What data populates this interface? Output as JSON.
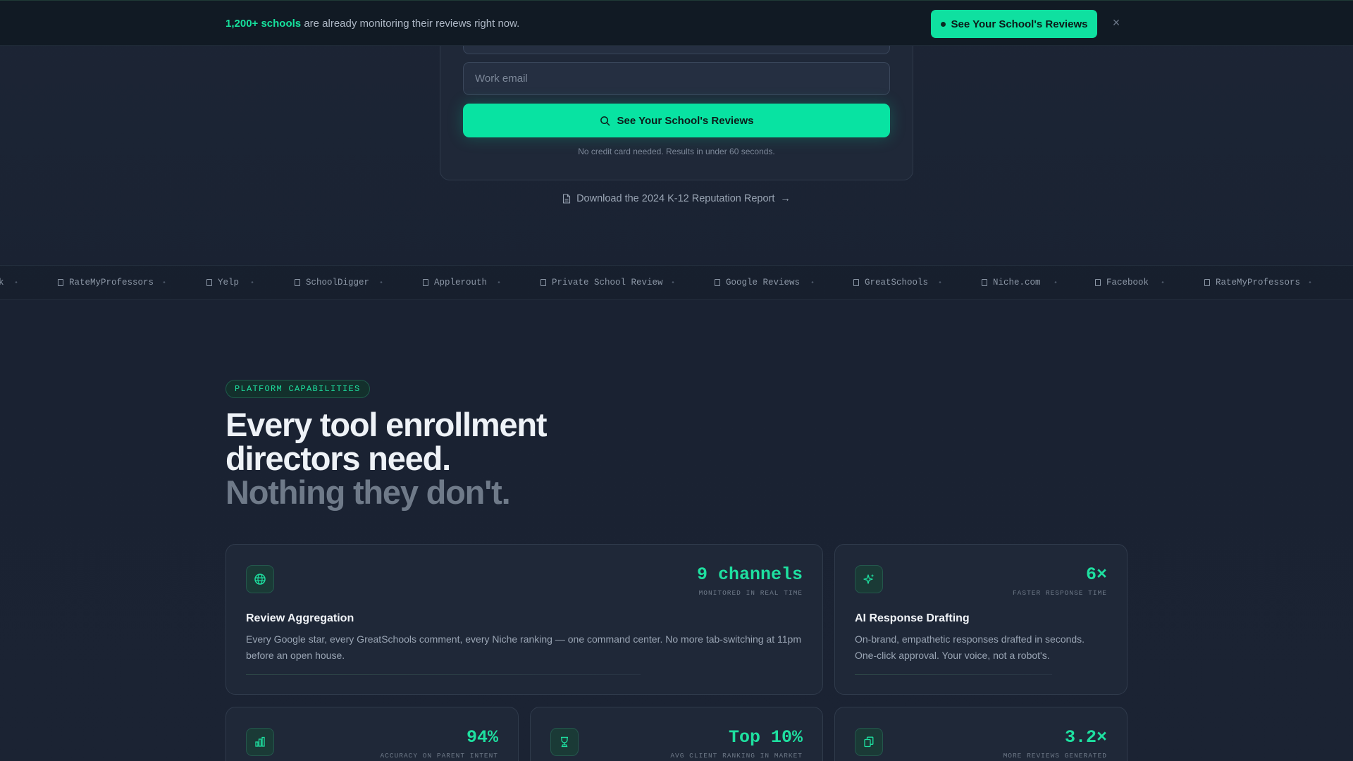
{
  "banner": {
    "highlight": "1,200+ schools",
    "text": " are already monitoring their reviews right now.",
    "button_label": "See Your School's Reviews",
    "close_glyph": "×"
  },
  "form": {
    "email_placeholder": "Work email",
    "cta_label": "See Your School's Reviews",
    "fine_print": "No credit card needed. Results in under 60 seconds.",
    "download_label": "Download the 2024 K-12 Reputation Report",
    "download_arrow": "→"
  },
  "marquee": {
    "leading": "k",
    "items": [
      "RateMyProfessors",
      "Yelp",
      "SchoolDigger",
      "Applerouth",
      "Private School Review",
      "Google Reviews",
      "GreatSchools",
      "Niche.com",
      "Facebook",
      "RateMyProfessors"
    ],
    "separator": "•"
  },
  "section": {
    "badge": "PLATFORM CAPABILITIES",
    "headline_line1": "Every tool enrollment",
    "headline_line2": "directors need.",
    "headline_line3": "Nothing they don't."
  },
  "cards": [
    {
      "icon": "globe-icon",
      "stat": "9 channels",
      "stat_label": "MONITORED IN REAL TIME",
      "title": "Review Aggregation",
      "desc": "Every Google star, every GreatSchools comment, every Niche ranking — one command center. No more tab-switching at 11pm before an open house."
    },
    {
      "icon": "sparkles-icon",
      "stat": "6×",
      "stat_label": "FASTER RESPONSE TIME",
      "title": "AI Response Drafting",
      "desc": "On-brand, empathetic responses drafted in seconds. One-click approval. Your voice, not a robot's."
    },
    {
      "icon": "bar-chart-icon",
      "stat": "94%",
      "stat_label": "ACCURACY ON PARENT INTENT"
    },
    {
      "icon": "trophy-icon",
      "stat": "Top 10%",
      "stat_label": "AVG CLIENT RANKING IN MARKET"
    },
    {
      "icon": "copy-icon",
      "stat": "3.2×",
      "stat_label": "MORE REVIEWS GENERATED"
    }
  ],
  "colors": {
    "accent": "#08e3a2",
    "background": "#1b2333",
    "card": "#1f2838"
  }
}
